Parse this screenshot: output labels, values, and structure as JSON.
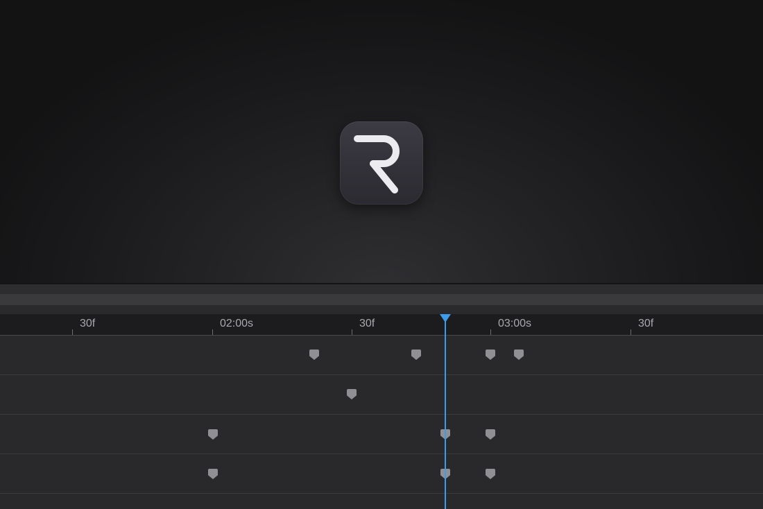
{
  "app": {
    "logo_letter": "R",
    "logo_icon": "r-app-icon"
  },
  "timeline": {
    "ruler_labels": [
      "30f",
      "02:00s",
      "30f",
      "03:00s",
      "30f"
    ],
    "playhead_color": "#3d9be9",
    "keyframe_color": "#909094",
    "track_count": 4
  }
}
